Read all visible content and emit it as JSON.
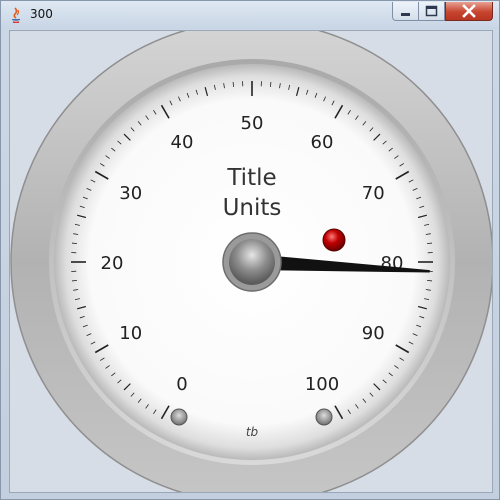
{
  "window": {
    "title": "300"
  },
  "gauge": {
    "title": "Title",
    "units": "Units",
    "scale_labels": [
      "0",
      "10",
      "20",
      "30",
      "40",
      "50",
      "60",
      "70",
      "80",
      "90",
      "100"
    ],
    "min": 0,
    "max": 100,
    "value": 81,
    "led_state": "on",
    "footer_label": "tb",
    "colors": {
      "needle": "#111111",
      "led": "#b00000",
      "bezel": "#b5b5b5",
      "dial_face": "#ffffff"
    }
  }
}
